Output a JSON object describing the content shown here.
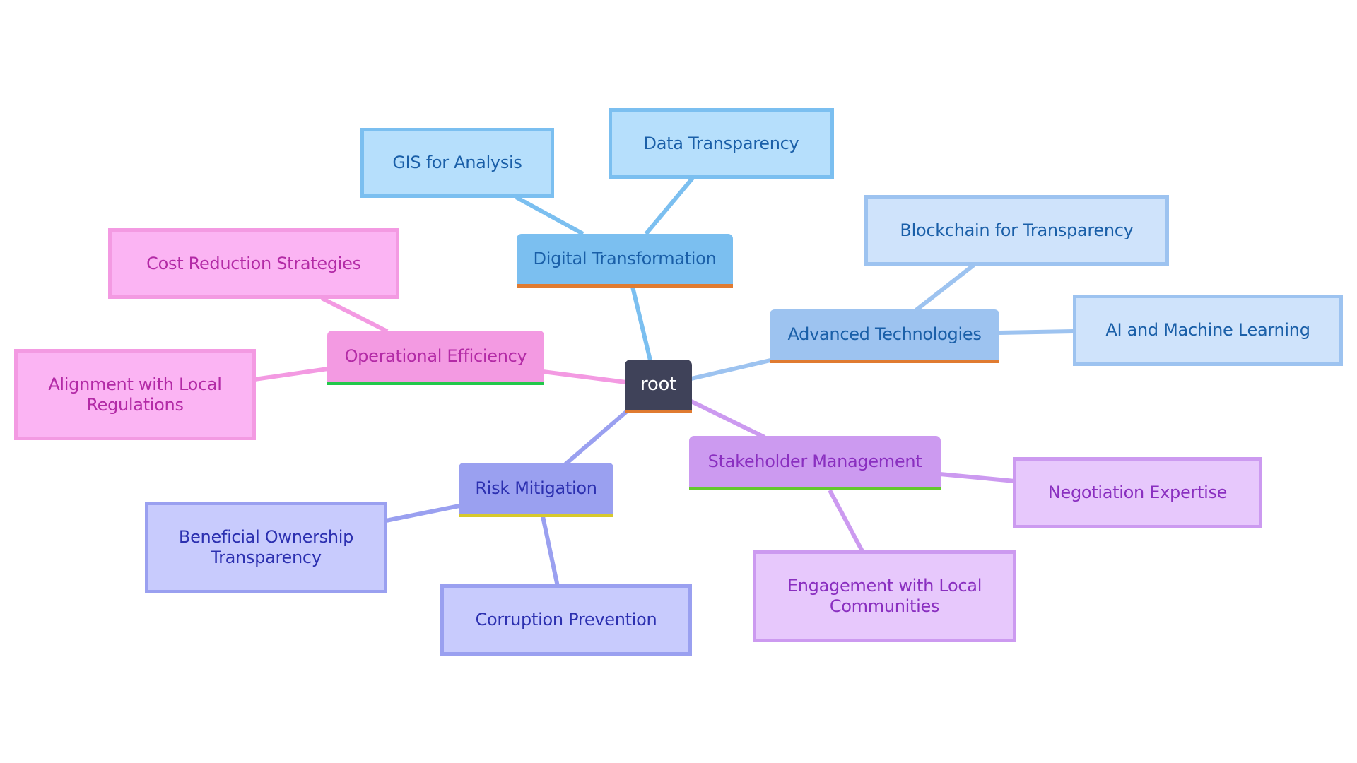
{
  "diagram": {
    "type": "mindmap",
    "root": {
      "label": "root"
    },
    "branches": [
      {
        "id": "digital",
        "label": "Digital Transformation",
        "color": "#7bbff0",
        "accent": "#e07b31",
        "children": [
          "GIS for Analysis",
          "Data Transparency"
        ]
      },
      {
        "id": "adv",
        "label": "Advanced Technologies",
        "color": "#9dc3f0",
        "accent": "#e07b31",
        "children": [
          "Blockchain for Transparency",
          "AI and Machine Learning"
        ]
      },
      {
        "id": "ops",
        "label": "Operational Efficiency",
        "color": "#f39ae2",
        "accent": "#22c84a",
        "children": [
          "Cost Reduction Strategies",
          "Alignment with Local Regulations"
        ]
      },
      {
        "id": "risk",
        "label": "Risk Mitigation",
        "color": "#9aa0f0",
        "accent": "#d7c92c",
        "children": [
          "Beneficial Ownership Transparency",
          "Corruption Prevention"
        ]
      },
      {
        "id": "stake",
        "label": "Stakeholder Management",
        "color": "#cc9af0",
        "accent": "#64c82c",
        "children": [
          "Negotiation Expertise",
          "Engagement with Local Communities"
        ]
      }
    ]
  }
}
